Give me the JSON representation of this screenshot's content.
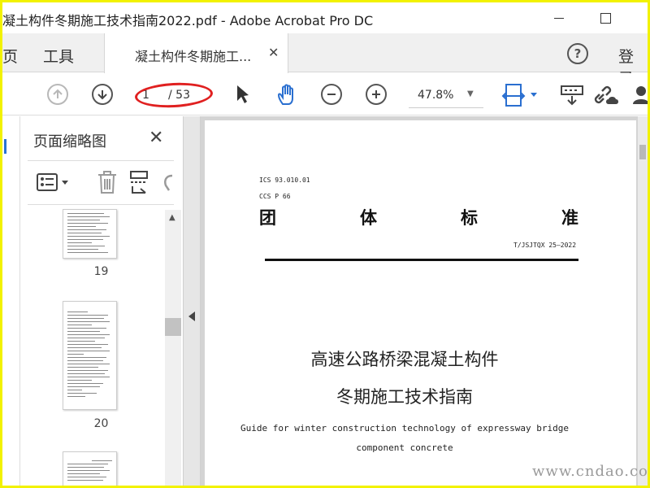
{
  "window": {
    "title": "凝土构件冬期施工技术指南2022.pdf - Adobe Acrobat Pro DC"
  },
  "tabs": {
    "home": "页",
    "tools": "工具",
    "document": "凝土构件冬期施工...",
    "login": "登录"
  },
  "toolbar": {
    "current_page": "1",
    "page_total": "/ 53",
    "zoom": "47.8%"
  },
  "thumbnails": {
    "title": "页面缩略图",
    "items": [
      {
        "page_label": "19"
      },
      {
        "page_label": "20"
      }
    ]
  },
  "document_page": {
    "ics": "ICS 93.010.01",
    "ccs": "CCS P 66",
    "heading_chars": [
      "团",
      "体",
      "标",
      "准"
    ],
    "code": "T/JSJTQX 25—2022",
    "title_line1": "高速公路桥梁混凝土构件",
    "title_line2": "冬期施工技术指南",
    "english_line1": "Guide for winter construction technology of expressway bridge",
    "english_line2": "component concrete"
  },
  "watermark": "www.cndao.com"
}
